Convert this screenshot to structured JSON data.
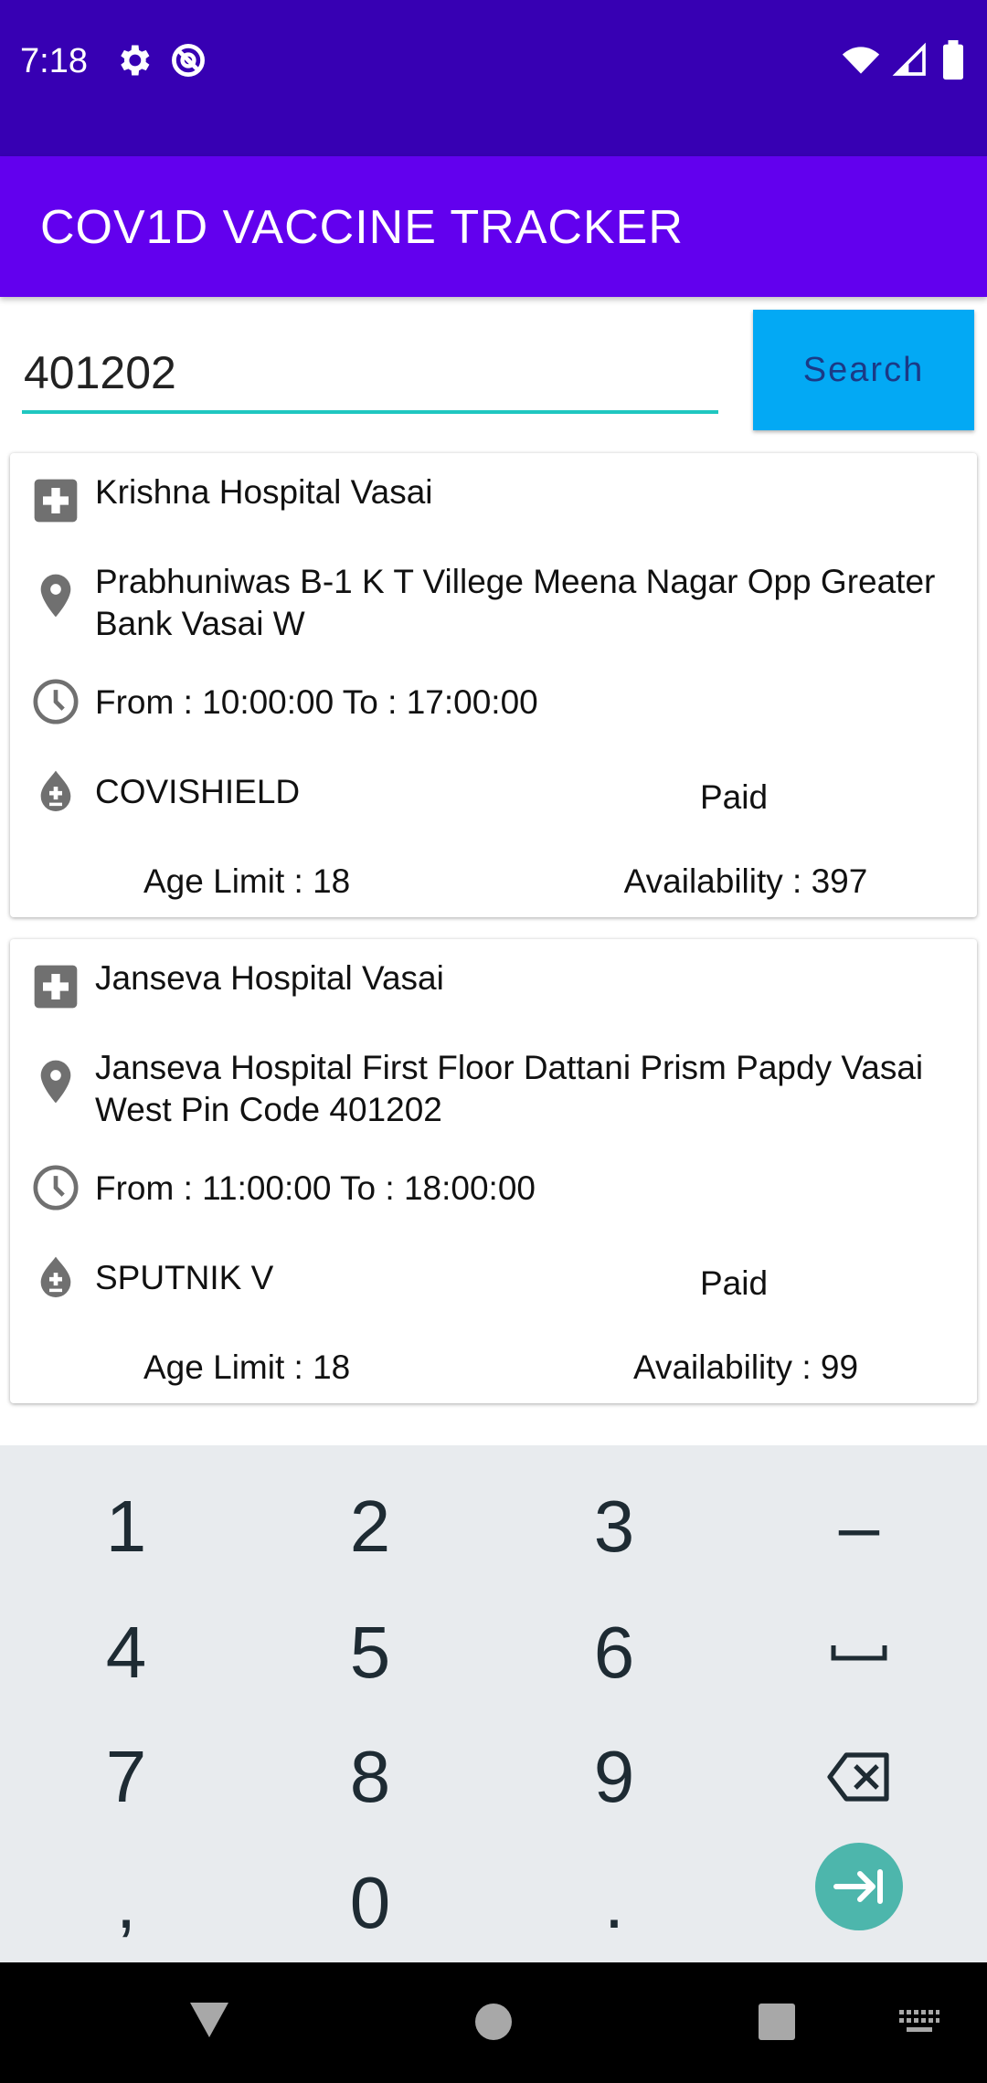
{
  "status_bar": {
    "time": "7:18"
  },
  "app_bar": {
    "title": "COV1D VACCINE TRACKER"
  },
  "search": {
    "value": "401202",
    "button_label": "Search"
  },
  "centers": [
    {
      "name": "Krishna Hospital Vasai",
      "address": "Prabhuniwas B-1 K T Villege Meena Nagar Opp Greater Bank Vasai W",
      "timing": "From : 10:00:00 To : 17:00:00",
      "vaccine": "COVISHIELD",
      "fee_type": "Paid",
      "age_limit": "Age Limit : 18",
      "availability": "Availability : 397"
    },
    {
      "name": "Janseva Hospital Vasai",
      "address": "Janseva Hospital First Floor  Dattani Prism  Papdy Vasai West Pin Code 401202",
      "timing": "From : 11:00:00 To : 18:00:00",
      "vaccine": "SPUTNIK V",
      "fee_type": "Paid",
      "age_limit": "Age Limit : 18",
      "availability": "Availability : 99"
    }
  ],
  "keyboard": {
    "keys": [
      "1",
      "2",
      "3",
      "–",
      "4",
      "5",
      "6",
      "",
      "7",
      "8",
      "9",
      "",
      ",",
      "0",
      ".",
      ""
    ]
  },
  "icons": {
    "hospital": "hospital-plus-icon",
    "location": "location-pin-icon",
    "time": "clock-icon",
    "vaccine": "vaccine-drop-icon"
  },
  "colors": {
    "status_bar": "#3700b3",
    "app_bar": "#6200ee",
    "accent": "#1fc7c0",
    "button": "#03a9f4"
  }
}
